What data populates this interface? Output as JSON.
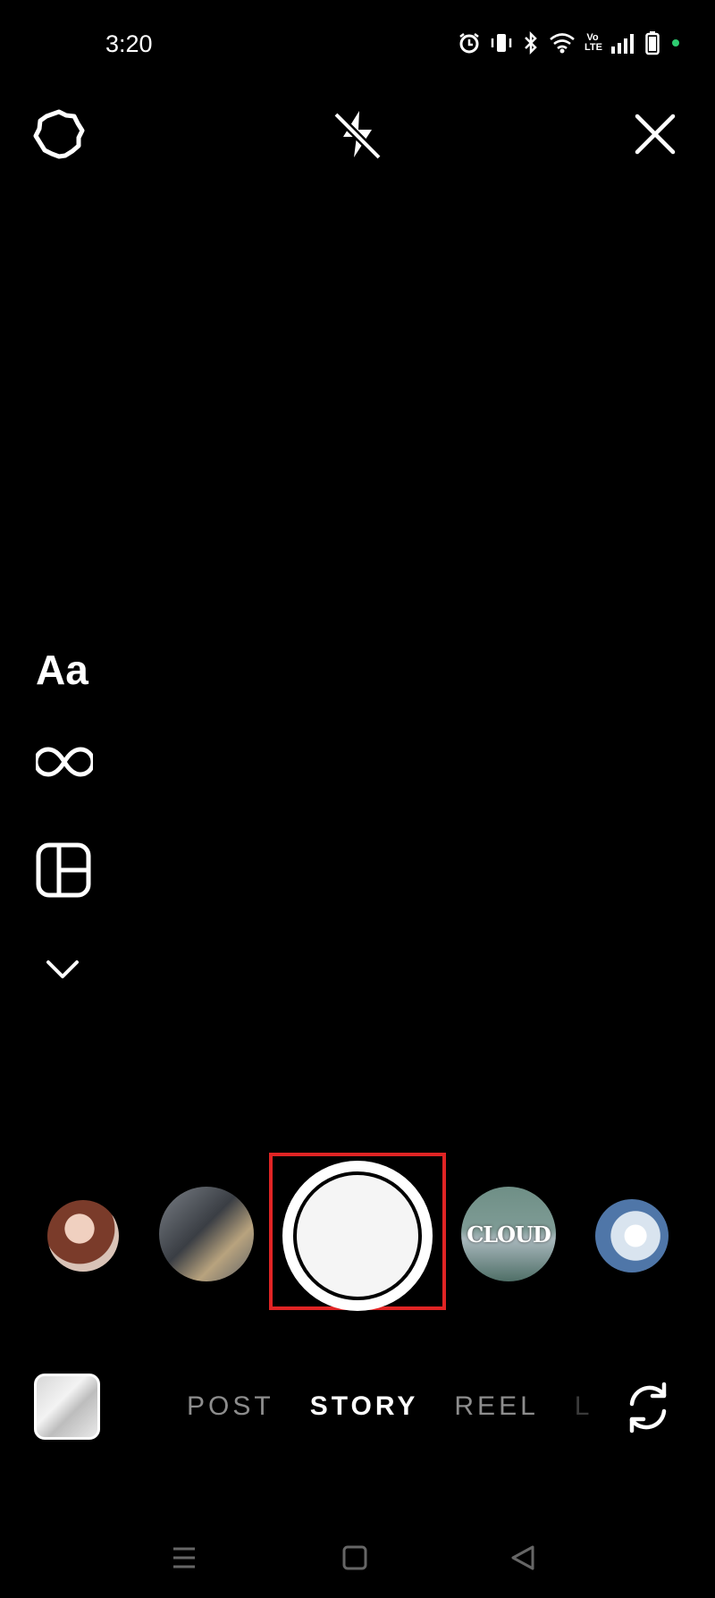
{
  "status_bar": {
    "time": "3:20",
    "icons": [
      "alarm-icon",
      "vibrate-icon",
      "bluetooth-icon",
      "wifi-icon",
      "volte-icon",
      "signal-icon",
      "battery-icon"
    ],
    "volte_label": "Vo LTE"
  },
  "top_controls": [
    "settings-icon",
    "flash-off-icon",
    "close-icon"
  ],
  "side_tools": {
    "text_label": "Aa",
    "icons": [
      "boomerang-icon",
      "layout-icon",
      "chevron-down-icon"
    ]
  },
  "effects": {
    "items": [
      "portrait-effect",
      "street-effect",
      "shutter",
      "cloud-effect",
      "sky-effect"
    ],
    "cloud_label": "CLOUD"
  },
  "modes": {
    "items": [
      "POST",
      "STORY",
      "REEL",
      "L"
    ],
    "active": "STORY"
  },
  "colors": {
    "background": "#000000",
    "highlight": "#e02424",
    "active_mode": "#ffffff",
    "inactive_mode": "#8d8d8d"
  }
}
